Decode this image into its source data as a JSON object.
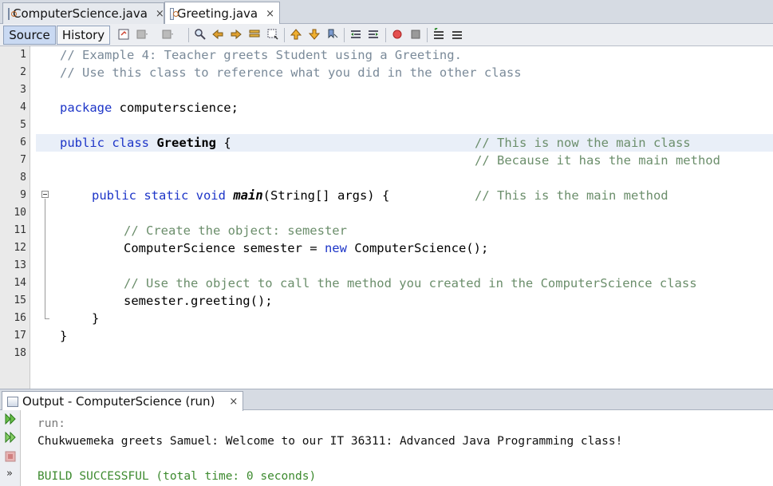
{
  "editor_tabs": [
    {
      "label": "ComputerScience.java",
      "close": "×",
      "active": false
    },
    {
      "label": "Greeting.java",
      "close": "×",
      "active": true
    }
  ],
  "view_toggle": {
    "source_label": "Source",
    "history_label": "History"
  },
  "toolbar_icons": [
    "last-edit-icon",
    "back-icon",
    "forward-icon",
    "find-icon",
    "find-previous-icon",
    "find-next-icon",
    "find-selection-icon",
    "toggle-highlight-icon",
    "previous-bookmark-icon",
    "next-bookmark-icon",
    "toggle-bookmark-icon",
    "shift-left-icon",
    "shift-right-icon",
    "start-macro-icon",
    "stop-macro-icon",
    "comment-icon",
    "uncomment-icon"
  ],
  "line_numbers": [
    "1",
    "2",
    "3",
    "4",
    "5",
    "6",
    "7",
    "8",
    "9",
    "10",
    "11",
    "12",
    "13",
    "14",
    "15",
    "16",
    "17",
    "18"
  ],
  "code": {
    "l1": "// Example 4: Teacher greets Student using a Greeting.",
    "l2": "// Use this class to reference what you did in the other class",
    "l4_kw": "package",
    "l4_rest": " computerscience;",
    "l6_kw": "public class",
    "l6_name": "Greeting",
    "l6_rest": " {",
    "l6_cmt": "// This is now the main class",
    "l7_cmt": "// Because it has the main method",
    "l9_kw": "public static void",
    "l9_name": "main",
    "l9_rest": "(String[] args) {",
    "l9_cmt": "// This is the main method",
    "l11": "// Create the object: semester",
    "l12_a": "ComputerScience semester = ",
    "l12_kw": "new",
    "l12_b": " ComputerScience();",
    "l14": "// Use the object to call the method you created in the ComputerScience class",
    "l15": "semester.greeting();",
    "l16": "}",
    "l17": "}"
  },
  "output": {
    "tab_label": "Output - ComputerScience (run)",
    "close": "×",
    "lines": {
      "run": "run:",
      "message": "Chukwuemeka greets Samuel: Welcome to our IT 36311: Advanced Java Programming class!",
      "build": "BUILD SUCCESSFUL (total time: 0 seconds)"
    },
    "side_more": "»"
  },
  "colors": {
    "keyword": "#1d35c8",
    "comment": "#7a8a99",
    "build_success": "#3c8a2e",
    "current_line": "#e9eff8"
  }
}
